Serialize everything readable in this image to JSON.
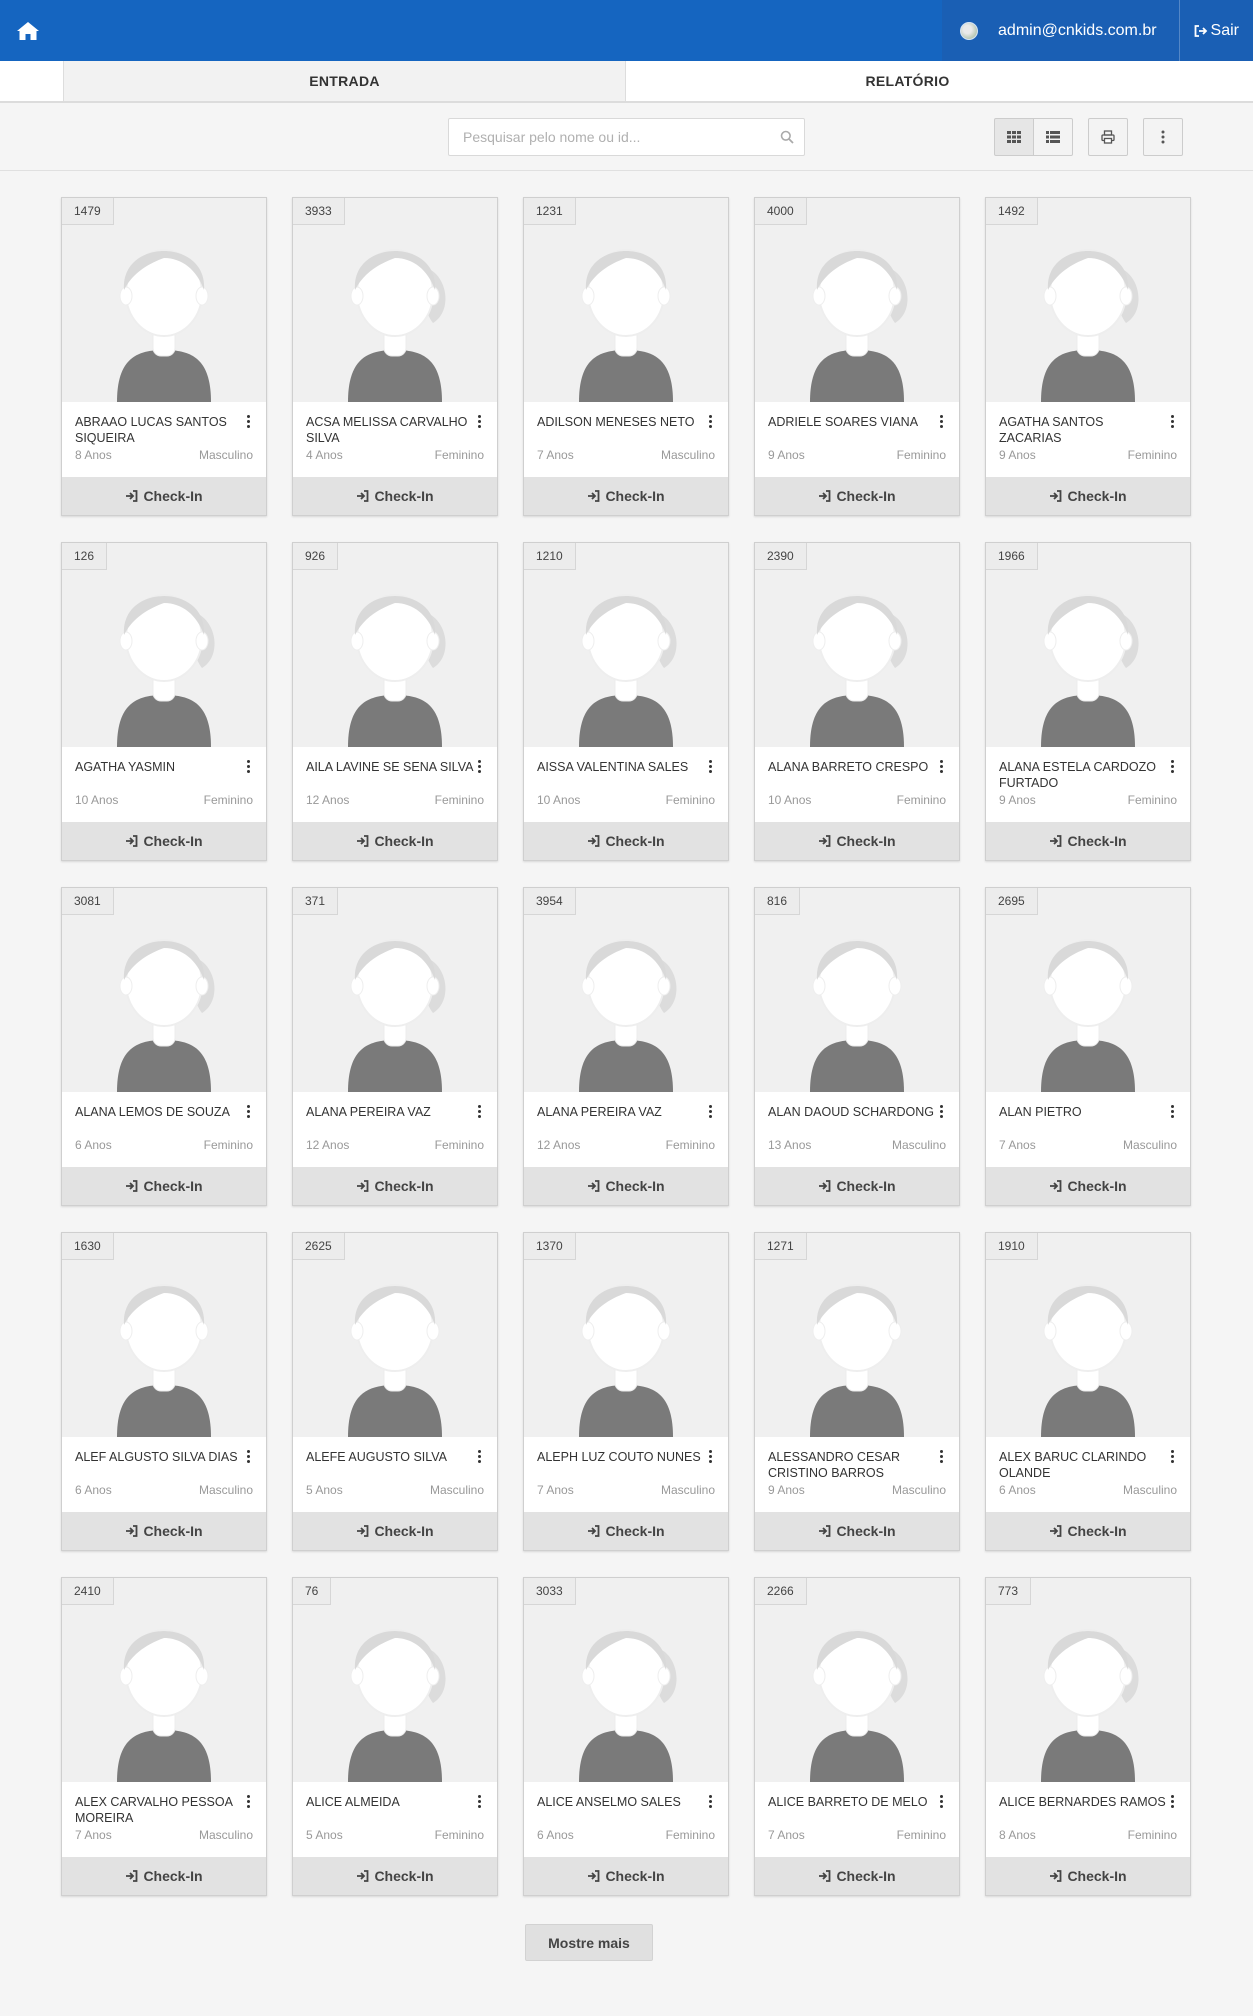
{
  "header": {
    "user_email": "admin@cnkids.com.br",
    "logout_label": "Sair",
    "brand_color": "#1565c0"
  },
  "tabs": [
    {
      "label": "ENTRADA",
      "active": true
    },
    {
      "label": "RELATÓRIO",
      "active": false
    }
  ],
  "search": {
    "placeholder": "Pesquisar pelo nome ou id...",
    "value": ""
  },
  "view_mode": "grid",
  "checkin_label": "Check-In",
  "show_more_label": "Mostre mais",
  "children": [
    {
      "id": "1479",
      "name": "ABRAAO LUCAS SANTOS SIQUEIRA",
      "age": "8 Anos",
      "sex": "Masculino"
    },
    {
      "id": "3933",
      "name": "ACSA MELISSA CARVALHO SILVA",
      "age": "4 Anos",
      "sex": "Feminino"
    },
    {
      "id": "1231",
      "name": "ADILSON MENESES NETO",
      "age": "7 Anos",
      "sex": "Masculino"
    },
    {
      "id": "4000",
      "name": "ADRIELE SOARES VIANA",
      "age": "9 Anos",
      "sex": "Feminino"
    },
    {
      "id": "1492",
      "name": "AGATHA SANTOS ZACARIAS",
      "age": "9 Anos",
      "sex": "Feminino"
    },
    {
      "id": "126",
      "name": "AGATHA YASMIN",
      "age": "10 Anos",
      "sex": "Feminino"
    },
    {
      "id": "926",
      "name": "AILA LAVINE SE SENA SILVA",
      "age": "12 Anos",
      "sex": "Feminino"
    },
    {
      "id": "1210",
      "name": "AISSA VALENTINA SALES",
      "age": "10 Anos",
      "sex": "Feminino"
    },
    {
      "id": "2390",
      "name": "ALANA BARRETO CRESPO",
      "age": "10 Anos",
      "sex": "Feminino"
    },
    {
      "id": "1966",
      "name": "ALANA ESTELA CARDOZO FURTADO",
      "age": "9 Anos",
      "sex": "Feminino"
    },
    {
      "id": "3081",
      "name": "ALANA LEMOS DE SOUZA",
      "age": "6 Anos",
      "sex": "Feminino"
    },
    {
      "id": "371",
      "name": "ALANA PEREIRA VAZ",
      "age": "12 Anos",
      "sex": "Feminino"
    },
    {
      "id": "3954",
      "name": "ALANA PEREIRA VAZ",
      "age": "12 Anos",
      "sex": "Feminino"
    },
    {
      "id": "816",
      "name": "ALAN DAOUD SCHARDONG",
      "age": "13 Anos",
      "sex": "Masculino"
    },
    {
      "id": "2695",
      "name": "ALAN PIETRO",
      "age": "7 Anos",
      "sex": "Masculino"
    },
    {
      "id": "1630",
      "name": "ALEF ALGUSTO SILVA DIAS",
      "age": "6 Anos",
      "sex": "Masculino"
    },
    {
      "id": "2625",
      "name": "ALEFE AUGUSTO SILVA",
      "age": "5 Anos",
      "sex": "Masculino"
    },
    {
      "id": "1370",
      "name": "ALEPH LUZ COUTO NUNES",
      "age": "7 Anos",
      "sex": "Masculino"
    },
    {
      "id": "1271",
      "name": "ALESSANDRO CESAR CRISTINO BARROS",
      "age": "9 Anos",
      "sex": "Masculino"
    },
    {
      "id": "1910",
      "name": "ALEX BARUC CLARINDO OLANDE",
      "age": "6 Anos",
      "sex": "Masculino"
    },
    {
      "id": "2410",
      "name": "ALEX CARVALHO PESSOA MOREIRA",
      "age": "7 Anos",
      "sex": "Masculino"
    },
    {
      "id": "76",
      "name": "ALICE ALMEIDA",
      "age": "5 Anos",
      "sex": "Feminino"
    },
    {
      "id": "3033",
      "name": "ALICE ANSELMO SALES",
      "age": "6 Anos",
      "sex": "Feminino"
    },
    {
      "id": "2266",
      "name": "ALICE BARRETO DE MELO",
      "age": "7 Anos",
      "sex": "Feminino"
    },
    {
      "id": "773",
      "name": "ALICE BERNARDES RAMOS",
      "age": "8 Anos",
      "sex": "Feminino"
    }
  ]
}
